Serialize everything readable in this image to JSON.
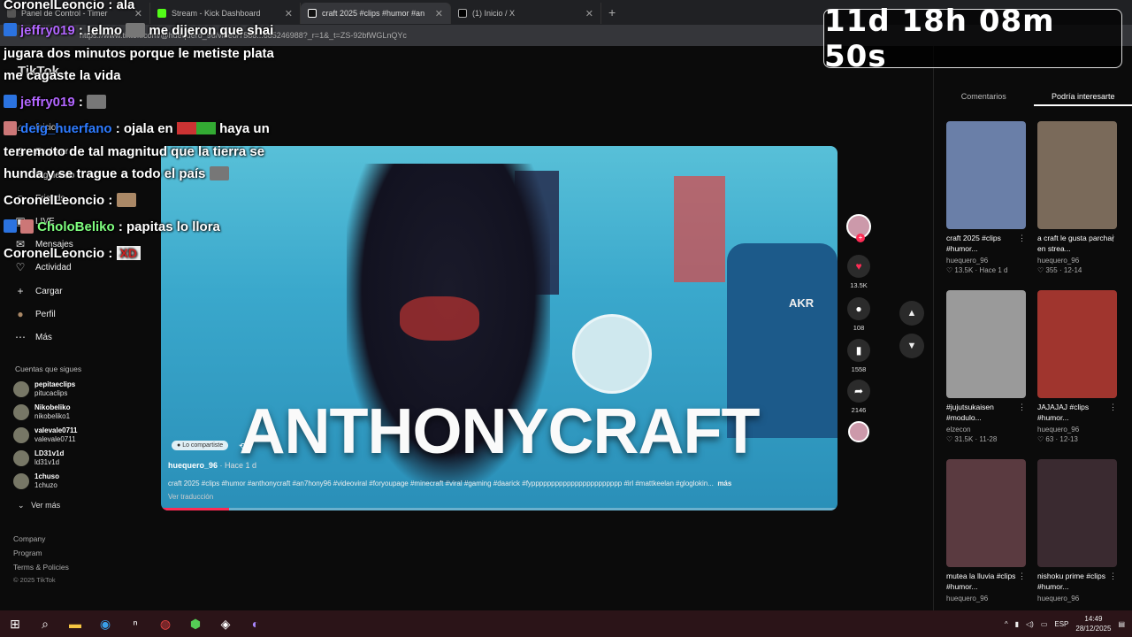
{
  "browser": {
    "tabs": [
      {
        "title": "Panel de Control - Timer",
        "active": false
      },
      {
        "title": "Stream - Kick Dashboard",
        "active": false
      },
      {
        "title": "craft 2025 #clips #humor #an",
        "active": true
      },
      {
        "title": "(1) Inicio / X",
        "active": false
      }
    ],
    "url": "https://www.tiktok.com/@huequero_96/video/7588...685246988?_r=1&_t=ZS-92bfWGLnQYc"
  },
  "sidebar": {
    "logo": "TikTok",
    "nav": [
      {
        "label": "Inicio",
        "icon": "home-icon",
        "glyph": "⌂"
      },
      {
        "label": "Explorar",
        "icon": "compass-icon",
        "glyph": "◎"
      },
      {
        "label": "Siguiendo",
        "icon": "following-icon",
        "glyph": "◌"
      },
      {
        "label": "Friends",
        "icon": "friends-icon",
        "glyph": "☺"
      },
      {
        "label": "LIVE",
        "icon": "live-icon",
        "glyph": "▣"
      },
      {
        "label": "Mensajes",
        "icon": "messages-icon",
        "glyph": "✉"
      },
      {
        "label": "Actividad",
        "icon": "activity-icon",
        "glyph": "♡"
      },
      {
        "label": "Cargar",
        "icon": "upload-icon",
        "glyph": "+"
      },
      {
        "label": "Perfil",
        "icon": "profile-icon",
        "glyph": "●"
      },
      {
        "label": "Más",
        "icon": "more-icon",
        "glyph": "⋯"
      }
    ],
    "following_title": "Cuentas que sigues",
    "following": [
      {
        "display": "pepitaeclips",
        "handle": "pitucaclips"
      },
      {
        "display": "Nikobeliko",
        "handle": "nikobeliko1"
      },
      {
        "display": "valevale0711",
        "handle": "valevale0711"
      },
      {
        "display": "LD31v1d",
        "handle": "ld31v1d"
      },
      {
        "display": "1chuso",
        "handle": "1chuzo"
      }
    ],
    "see_more": "Ver más",
    "footer": [
      "Company",
      "Program",
      "Terms & Policies",
      "© 2025 TikTok"
    ]
  },
  "video": {
    "overlay_text": "ANTHONYCRAFT",
    "shared_pill": "Lo compartiste",
    "author": "huequero_96",
    "time": "· Hace 1 d",
    "description": "craft 2025 #clips #humor #anthonycraft #an7hony96 #videoviral #foryoupage #minecraft #viral #gaming #daarick #fyppppppppppppppppppppppp #irl #mattkeelan #gloglokin...",
    "more": "más",
    "translation": "Ver traducción",
    "progress": 0.1,
    "actions": {
      "likes": "13.5K",
      "comments": "108",
      "saves": "1558",
      "shares": "2146"
    }
  },
  "right_panel": {
    "tabs": [
      "Comentarios",
      "Podría interesarte"
    ],
    "active_tab": "Podría interesarte",
    "cards": [
      {
        "title": "craft 2025 #clips #humor...",
        "author": "huequero_96",
        "likes": "13.5K",
        "time": "Hace 1 d",
        "color": "#6a7fa8"
      },
      {
        "title": "a craft le gusta parchar en strea...",
        "author": "huequero_96",
        "likes": "355",
        "time": "12-14",
        "color": "#7a6a5a"
      },
      {
        "title": "#jujutsukaisen #modulo...",
        "author": "elzecon",
        "likes": "31.5K",
        "time": "11-28",
        "color": "#9a9a9a"
      },
      {
        "title": "JAJAJAJ #clips #humor...",
        "author": "huequero_96",
        "likes": "63",
        "time": "12-13",
        "color": "#a0352e"
      },
      {
        "title": "mutea la lluvia #clips #humor...",
        "author": "huequero_96",
        "likes": "",
        "time": "",
        "color": "#5a3a40"
      },
      {
        "title": "nishoku prime #clips #humor...",
        "author": "huequero_96",
        "likes": "",
        "time": "",
        "color": "#3a2a30"
      }
    ]
  },
  "chat": [
    {
      "user": "CoronelLeoncio",
      "user_color": "#ffffff",
      "message": ": ala",
      "badge": false
    },
    {
      "user": "jeffry019",
      "user_color": "#b266ff",
      "message": ": !elmo",
      "message2": "me dijeron que shai",
      "badge": true
    },
    {
      "user": "",
      "user_color": "#ffffff",
      "message": "jugara dos minutos porque le metiste plata",
      "badge": false
    },
    {
      "user": "",
      "user_color": "#ffffff",
      "message": "me cagaste la vida",
      "badge": false
    },
    {
      "user": "jeffry019",
      "user_color": "#b266ff",
      "message": ":",
      "badge": true
    },
    {
      "user": "deig_huerfano",
      "user_color": "#2e7bff",
      "message": ": ojala en",
      "message2": "haya un",
      "badge": false
    },
    {
      "user": "",
      "user_color": "#ffffff",
      "message": "terremoto de tal magnitud que la tierra se",
      "badge": false
    },
    {
      "user": "",
      "user_color": "#ffffff",
      "message": "hunda y se trague a todo el país",
      "badge": false
    },
    {
      "user": "CoronelLeoncio",
      "user_color": "#ffffff",
      "message": ":",
      "badge": false
    },
    {
      "user": "CholoBeliko",
      "user_color": "#7fff7f",
      "message": ": papitas lo llora",
      "badge": true
    },
    {
      "user": "CoronelLeoncio",
      "user_color": "#ffffff",
      "message": ":",
      "badge": false,
      "xd": "XD"
    }
  ],
  "timer": {
    "text": "11d 18h 08m 50s"
  },
  "taskbar": {
    "lang": "ESP",
    "time": "14:49",
    "date": "28/12/2025"
  },
  "colors": {
    "tiktok_red": "#fe2c55",
    "kick_green": "#53fc18",
    "badge_blue": "#2b73e0"
  }
}
